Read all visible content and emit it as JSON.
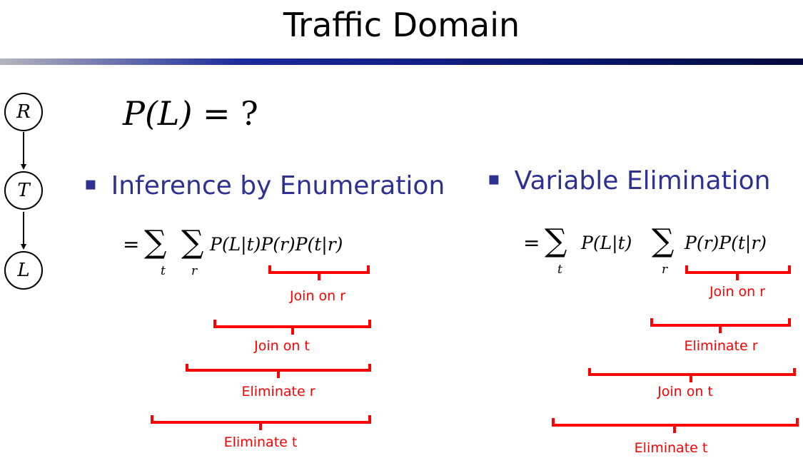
{
  "title": "Traffic Domain",
  "network": {
    "nodes": [
      "R",
      "T",
      "L"
    ]
  },
  "query": {
    "lhs": "P(L)",
    "rhs": "= ?"
  },
  "left": {
    "heading": "Inference by Enumeration",
    "formula": {
      "eq": "=",
      "sum1_var": "t",
      "sum2_var": "r",
      "terms": "P(L|t)P(r)P(t|r)"
    },
    "steps": [
      "Join on r",
      "Join on t",
      "Eliminate r",
      "Eliminate t"
    ]
  },
  "right": {
    "heading": "Variable Elimination",
    "formula": {
      "eq": "=",
      "sum1_var": "t",
      "term1": "P(L|t)",
      "sum2_var": "r",
      "term2": "P(r)P(t|r)"
    },
    "steps": [
      "Join on r",
      "Eliminate r",
      "Join on t",
      "Eliminate t"
    ]
  },
  "colors": {
    "heading": "#2e3092",
    "annotation": "#ff0000"
  }
}
